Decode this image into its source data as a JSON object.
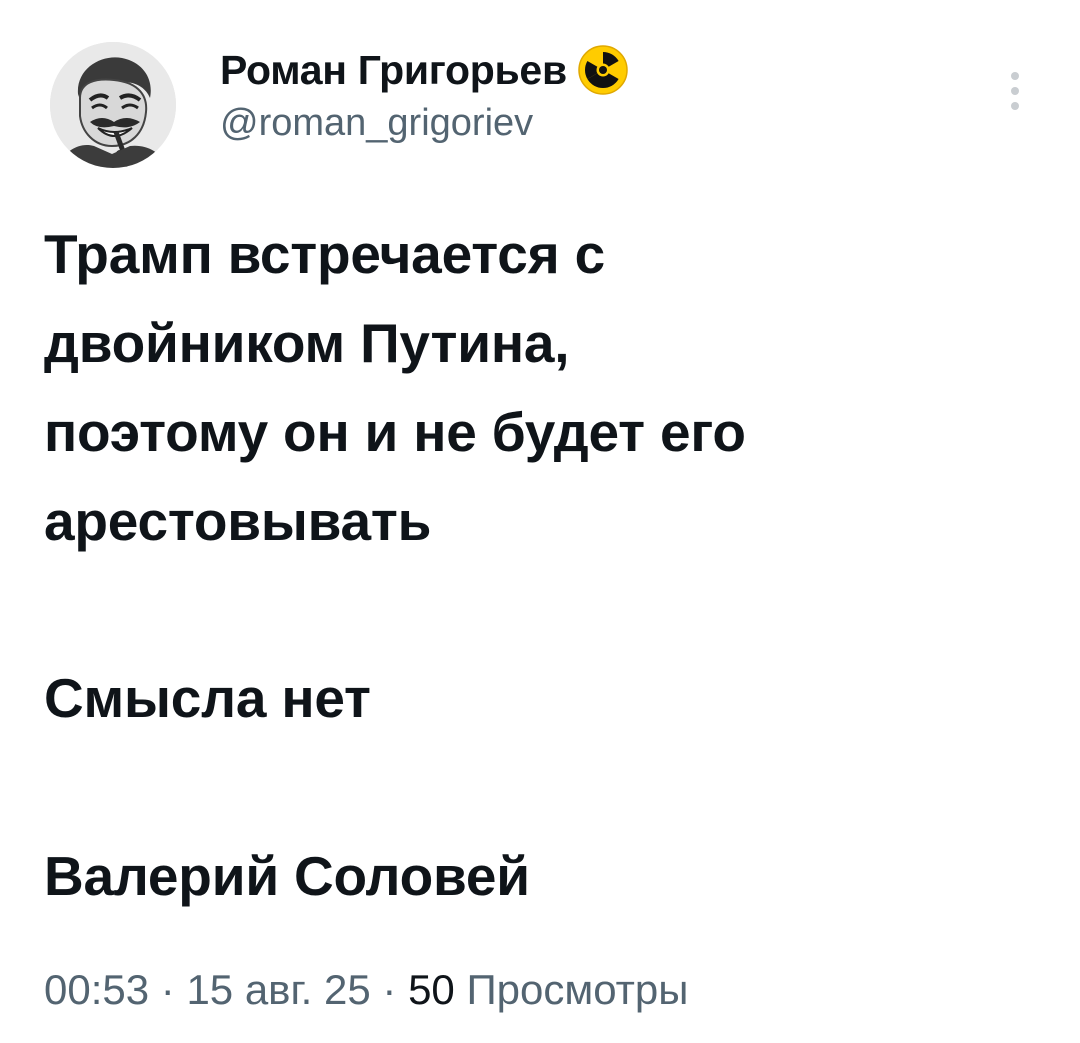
{
  "author": {
    "display_name": "Роман Григорьев",
    "handle": "@roman_grigoriev",
    "badge_icon": "radioactive-icon",
    "avatar_icon": "cartoon-face-avatar"
  },
  "menu": {
    "icon": "more-vertical-icon"
  },
  "tweet": {
    "lines": [
      "Трамп встречается с",
      "двойником Путина,",
      "поэтому он и не будет его",
      "арестовывать"
    ],
    "paragraph2": "Смысла нет",
    "paragraph3": "Валерий Соловей"
  },
  "meta": {
    "time": "00:53",
    "separator": "·",
    "date": "15 авг. 25",
    "views_count": "50",
    "views_label": "Просмотры"
  },
  "colors": {
    "text_primary": "#0f1419",
    "text_secondary": "#536471",
    "badge_yellow": "#ffcc00",
    "background": "#ffffff"
  }
}
